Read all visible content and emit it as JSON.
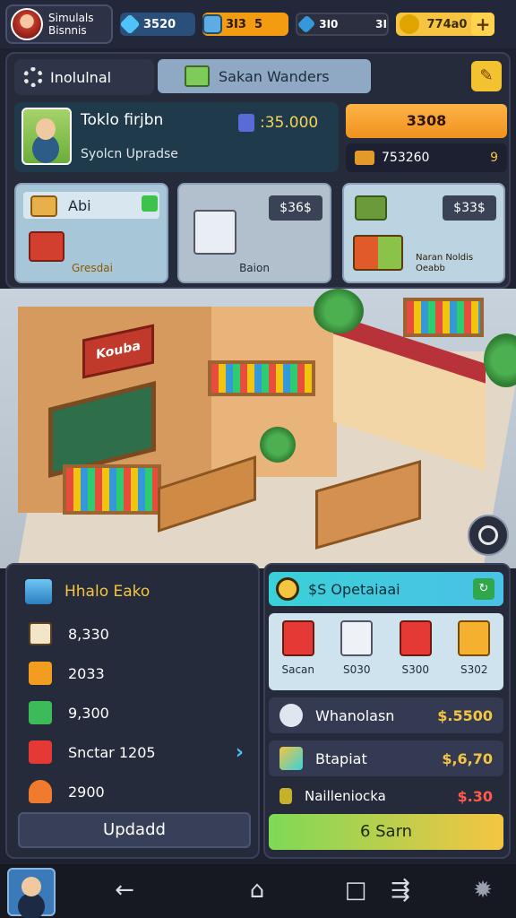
{
  "brand": {
    "line1": "Simulals",
    "line2": "Bisnnis"
  },
  "resources": [
    {
      "icon": "gem-icon",
      "value": "3520"
    },
    {
      "icon": "bank-icon",
      "value": "3I3  5"
    },
    {
      "icon": "crystal-icon",
      "value": "3I0          3I"
    },
    {
      "icon": "coin-icon",
      "value": "774a0"
    }
  ],
  "top": {
    "tab_main": "Inolulnal",
    "tab_second": "Sakan Wanders",
    "profile_name": "Toklo firjbn",
    "profile_value": ":35.000",
    "profile_sub": "Syolcn Upradse",
    "gold_button": "3308",
    "stat_value": "753260",
    "stat_end": "9",
    "cards": [
      {
        "top": "Abi",
        "bottom": "Gresdai"
      },
      {
        "price": "$36$",
        "bottom": "Baion"
      },
      {
        "price": "$33$",
        "bottom": "Naran Noldis Oeabb"
      }
    ]
  },
  "scene": {
    "sign": "Kouba"
  },
  "left_panel": {
    "title": "Hhalo Eako",
    "rows": [
      {
        "icon": "checkbox-icon",
        "value": "8,330",
        "color": "#f3e6c8"
      },
      {
        "icon": "edit-icon",
        "value": "2033",
        "color": "#f29c20"
      },
      {
        "icon": "ledger-icon",
        "value": "9,300",
        "color": "#3dbb5a"
      },
      {
        "icon": "calendar-icon",
        "value": "Snctar 1205",
        "color": "#e53935"
      },
      {
        "icon": "home-icon",
        "value": "2900",
        "color": "#f07a2e"
      }
    ],
    "button": "Updadd"
  },
  "right_panel": {
    "title": "$S Opetaiaai",
    "items": [
      {
        "icon": "machine-icon",
        "label": "Sacan",
        "color": "#e53935"
      },
      {
        "icon": "box-icon",
        "label": "S030",
        "color": "#eef2f6"
      },
      {
        "icon": "cart-icon",
        "label": "S300",
        "color": "#e53935"
      },
      {
        "icon": "gift-icon",
        "label": "S302",
        "color": "#f5b030"
      }
    ],
    "rows": [
      {
        "icon": "person-icon",
        "label": "Whanolasn",
        "value": "$.5500"
      },
      {
        "icon": "cube-icon",
        "label": "Btapiat",
        "value": "$,6,70"
      },
      {
        "icon": "key-icon",
        "label": "Nailleniocka",
        "value": "$.30"
      }
    ],
    "button": "6 Sarn"
  },
  "nav": {
    "icons": [
      "back-icon",
      "home-icon",
      "recent-icon",
      "share-icon",
      "settings-icon"
    ]
  }
}
